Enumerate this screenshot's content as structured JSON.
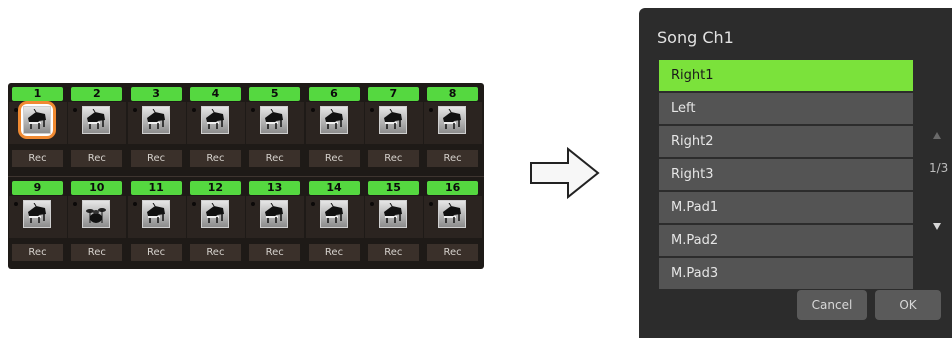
{
  "channels": [
    {
      "number": "1",
      "instrument": "grand-piano-icon",
      "rec": "Rec",
      "selected": true
    },
    {
      "number": "2",
      "instrument": "grand-piano-icon",
      "rec": "Rec"
    },
    {
      "number": "3",
      "instrument": "grand-piano-icon",
      "rec": "Rec"
    },
    {
      "number": "4",
      "instrument": "grand-piano-icon",
      "rec": "Rec"
    },
    {
      "number": "5",
      "instrument": "grand-piano-icon",
      "rec": "Rec"
    },
    {
      "number": "6",
      "instrument": "grand-piano-icon",
      "rec": "Rec"
    },
    {
      "number": "7",
      "instrument": "grand-piano-icon",
      "rec": "Rec"
    },
    {
      "number": "8",
      "instrument": "grand-piano-icon",
      "rec": "Rec"
    },
    {
      "number": "9",
      "instrument": "grand-piano-icon",
      "rec": "Rec"
    },
    {
      "number": "10",
      "instrument": "drum-kit-icon",
      "rec": "Rec"
    },
    {
      "number": "11",
      "instrument": "grand-piano-icon",
      "rec": "Rec"
    },
    {
      "number": "12",
      "instrument": "grand-piano-icon",
      "rec": "Rec"
    },
    {
      "number": "13",
      "instrument": "grand-piano-icon",
      "rec": "Rec"
    },
    {
      "number": "14",
      "instrument": "grand-piano-icon",
      "rec": "Rec"
    },
    {
      "number": "15",
      "instrument": "grand-piano-icon",
      "rec": "Rec"
    },
    {
      "number": "16",
      "instrument": "grand-piano-icon",
      "rec": "Rec"
    }
  ],
  "arrow": {
    "icon": "right-arrow-icon"
  },
  "dialog": {
    "title": "Song Ch1",
    "items": [
      "Right1",
      "Left",
      "Right2",
      "Right3",
      "M.Pad1",
      "M.Pad2",
      "M.Pad3"
    ],
    "selected_index": 0,
    "page_indicator": "1/3",
    "cancel_label": "Cancel",
    "ok_label": "OK"
  },
  "colors": {
    "channel_number_bg": "#55d840",
    "selected_item": "#7be23b",
    "selection_ring": "#f08a32",
    "dialog_bg": "#2c2c2c"
  }
}
